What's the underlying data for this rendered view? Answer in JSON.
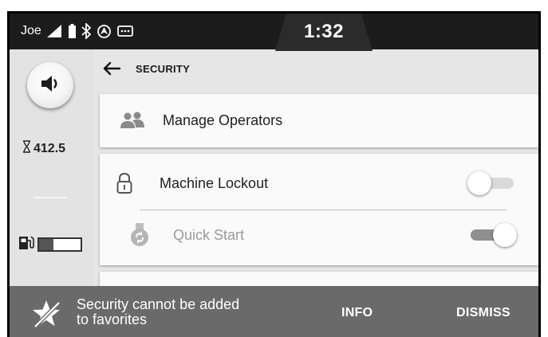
{
  "status_bar": {
    "user": "Joe",
    "time": "1:32",
    "icons": [
      "signal-icon",
      "battery-icon",
      "bluetooth-icon",
      "gps-icon",
      "message-icon"
    ]
  },
  "rail": {
    "volume_icon": "speaker-icon",
    "hours_icon": "hourglass-icon",
    "hours_value": "412.5",
    "fuel_icon": "fuel-pump-icon",
    "fuel_level": 0.35
  },
  "header": {
    "back_icon": "arrow-left-icon",
    "title": "SECURITY"
  },
  "list": {
    "manage_operators": {
      "label": "Manage Operators",
      "icon": "people-icon"
    },
    "machine_lockout": {
      "label": "Machine Lockout",
      "icon": "lock-icon",
      "enabled": false
    },
    "quick_start": {
      "label": "Quick Start",
      "icon": "quick-start-medal-icon",
      "enabled": true,
      "disabled_look": true
    }
  },
  "snackbar": {
    "icon": "favorite-star-crossed-icon",
    "message_line1": "Security cannot be added",
    "message_line2": "to favorites",
    "info_label": "INFO",
    "dismiss_label": "DISMISS"
  },
  "colors": {
    "status_bar_bg": "#1c1c1c",
    "page_bg": "#e6e6e6",
    "card_bg": "#fafafa",
    "snackbar_bg": "#6a6a6a",
    "toggle_off_track": "#d9d9d9",
    "toggle_on_track": "#8f8f8f"
  }
}
